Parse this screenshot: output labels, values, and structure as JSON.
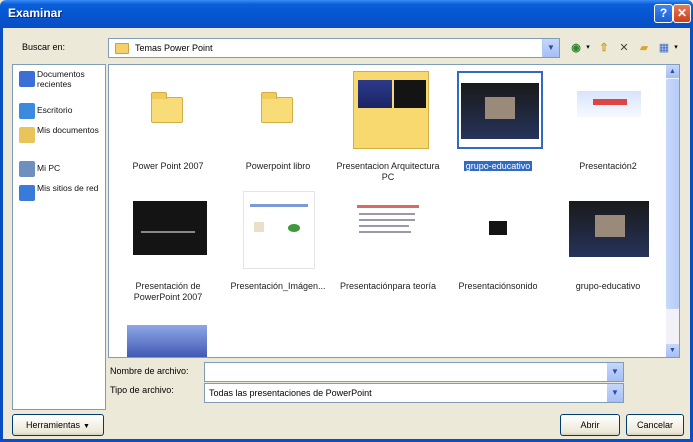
{
  "window": {
    "title": "Examinar"
  },
  "titlebar": {
    "help_glyph": "?",
    "close_glyph": "✕"
  },
  "toolbar": {
    "lookin_label": "Buscar en:",
    "lookin_value": "Temas Power Point",
    "back_icon": "back-arrow-icon",
    "up_icon": "up-folder-icon",
    "delete_icon": "delete-icon",
    "new_folder_icon": "new-folder-icon",
    "views_icon": "views-icon"
  },
  "places": [
    {
      "label": "Documentos recientes",
      "icon": "recent-docs-icon",
      "color": "#3b6fd6"
    },
    {
      "label": "Escritorio",
      "icon": "desktop-icon",
      "color": "#3a8ae0"
    },
    {
      "label": "Mis documentos",
      "icon": "my-documents-icon",
      "color": "#e8c45a"
    },
    {
      "label": "Mi PC",
      "icon": "my-computer-icon",
      "color": "#6f8fbf"
    },
    {
      "label": "Mis sitios de red",
      "icon": "network-places-icon",
      "color": "#3a7ad8"
    }
  ],
  "files": [
    {
      "name": "Power Point 2007",
      "kind": "folder"
    },
    {
      "name": "Powerpoint libro",
      "kind": "folder"
    },
    {
      "name": "Presentacion Arquitectura PC",
      "kind": "folder-preview"
    },
    {
      "name": "grupo-educativo",
      "kind": "slide-photo",
      "selected": true
    },
    {
      "name": "Presentación2",
      "kind": "slide-light"
    },
    {
      "name": "Presentación de PowerPoint 2007",
      "kind": "slide-dark"
    },
    {
      "name": "Presentación_Imágen...",
      "kind": "slide-white"
    },
    {
      "name": "Presentaciónpara teoría",
      "kind": "slide-text"
    },
    {
      "name": "Presentaciónsonido",
      "kind": "slide-black"
    },
    {
      "name": "grupo-educativo",
      "kind": "slide-photo"
    },
    {
      "name": "",
      "kind": "slide-blue-partial"
    }
  ],
  "bottom": {
    "filename_label": "Nombre de archivo:",
    "filename_value": "",
    "filetype_label": "Tipo de archivo:",
    "filetype_value": "Todas las presentaciones de PowerPoint",
    "tools_button": "Herramientas",
    "open_button": "Abrir",
    "cancel_button": "Cancelar"
  },
  "colors": {
    "titlebar": "#0554d0",
    "selection": "#316ac5",
    "dialog_bg": "#ece9d8"
  }
}
